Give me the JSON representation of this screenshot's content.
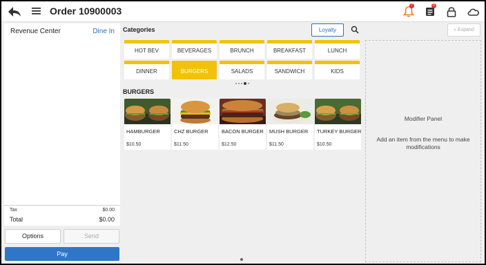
{
  "header": {
    "order_title": "Order 10900003",
    "notification_badge": "7",
    "tickets_badge": "0"
  },
  "order": {
    "revenue_center_label": "Revenue Center",
    "revenue_center_value": "Dine In",
    "tax_label": "Tax",
    "tax_value": "$0.00",
    "total_label": "Total",
    "total_value": "$0.00",
    "options_label": "Options",
    "send_label": "Send",
    "pay_label": "Pay"
  },
  "categories": {
    "heading": "Categories",
    "loyalty_label": "Loyalty",
    "items": [
      {
        "label": "HOT BEV",
        "active": false
      },
      {
        "label": "BEVERAGES",
        "active": false
      },
      {
        "label": "BRUNCH",
        "active": false
      },
      {
        "label": "BREAKFAST",
        "active": false
      },
      {
        "label": "LUNCH",
        "active": false
      },
      {
        "label": "DINNER",
        "active": false
      },
      {
        "label": "BURGERS",
        "active": true
      },
      {
        "label": "SALADS",
        "active": false
      },
      {
        "label": "SANDWICH",
        "active": false
      },
      {
        "label": "KIDS",
        "active": false
      }
    ],
    "page_count": 5,
    "current_page": 4
  },
  "menu": {
    "heading": "BURGERS",
    "items": [
      {
        "name": "HAMBURGER",
        "price": "$10.50"
      },
      {
        "name": "CHZ BURGER",
        "price": "$11.50"
      },
      {
        "name": "BACON BURGER",
        "price": "$12.50"
      },
      {
        "name": "MUSH BURGER",
        "price": "$11.50"
      },
      {
        "name": "TURKEY BURGER",
        "price": "$10.50"
      }
    ]
  },
  "modifier": {
    "expand_label": "Expand",
    "title": "Modifier Panel",
    "description": "Add an item from the menu to make modifications"
  },
  "colors": {
    "accent_blue": "#2f76c9",
    "category_yellow": "#f2c20a",
    "badge_red": "#e03030"
  }
}
